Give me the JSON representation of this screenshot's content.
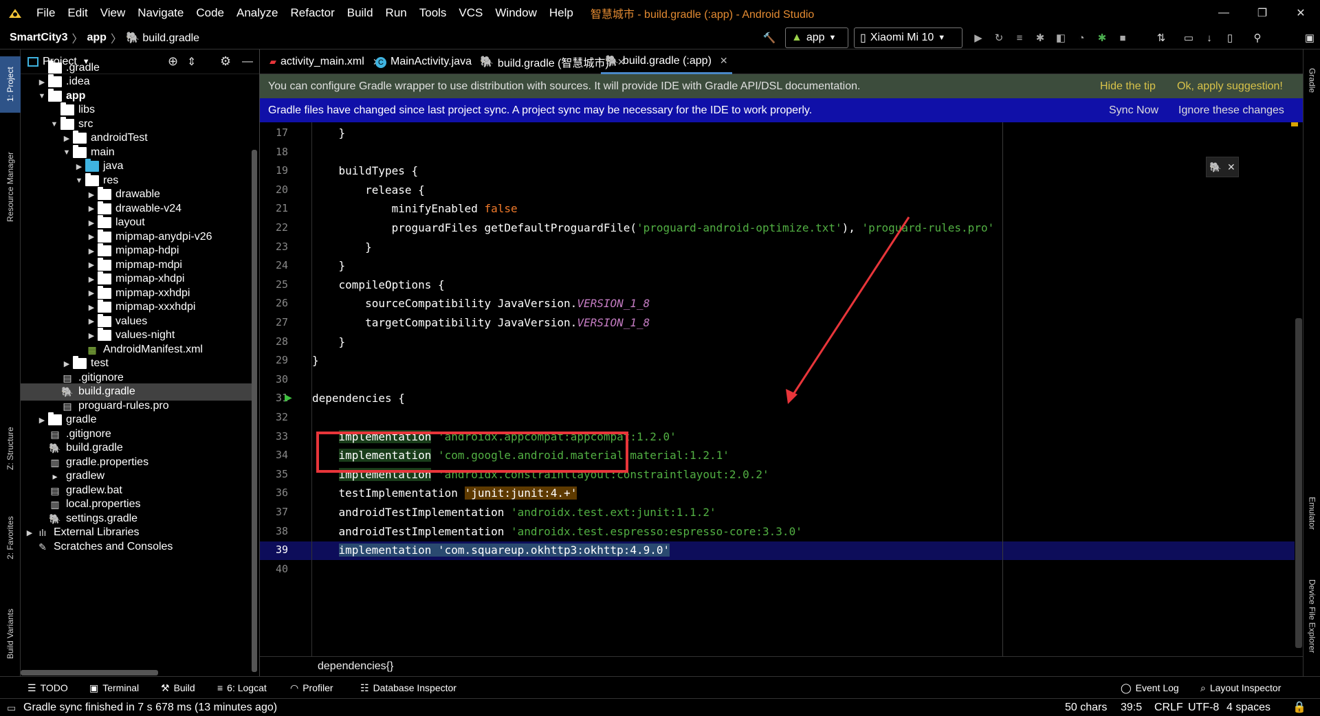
{
  "menubar": {
    "items": [
      "File",
      "Edit",
      "View",
      "Navigate",
      "Code",
      "Analyze",
      "Refactor",
      "Build",
      "Run",
      "Tools",
      "VCS",
      "Window",
      "Help"
    ],
    "window_title": "智慧城市 - build.gradle (:app) - Android Studio"
  },
  "navbar": {
    "crumbs": [
      "SmartCity3",
      "app",
      "build.gradle"
    ],
    "run_config": "app",
    "device": "Xiaomi Mi 10"
  },
  "left_strip": {
    "tabs": [
      "1: Project",
      "Resource Manager",
      "Z: Structure",
      "2: Favorites",
      "Build Variants"
    ]
  },
  "right_strip": {
    "tabs": [
      "Gradle",
      "Emulator",
      "Device File Explorer"
    ]
  },
  "project_panel": {
    "title": "Project",
    "tree": [
      {
        "label": ".gradle",
        "indent": 1,
        "arrow": "",
        "icon": "folder"
      },
      {
        "label": ".idea",
        "indent": 1,
        "arrow": "▶",
        "icon": "folder"
      },
      {
        "label": "app",
        "indent": 1,
        "arrow": "▼",
        "icon": "folder",
        "bold": true
      },
      {
        "label": "libs",
        "indent": 2,
        "arrow": "",
        "icon": "folder"
      },
      {
        "label": "src",
        "indent": 2,
        "arrow": "▼",
        "icon": "folder"
      },
      {
        "label": "androidTest",
        "indent": 3,
        "arrow": "▶",
        "icon": "folder"
      },
      {
        "label": "main",
        "indent": 3,
        "arrow": "▼",
        "icon": "folder"
      },
      {
        "label": "java",
        "indent": 4,
        "arrow": "▶",
        "icon": "folder-blue"
      },
      {
        "label": "res",
        "indent": 4,
        "arrow": "▼",
        "icon": "folder"
      },
      {
        "label": "drawable",
        "indent": 5,
        "arrow": "▶",
        "icon": "folder"
      },
      {
        "label": "drawable-v24",
        "indent": 5,
        "arrow": "▶",
        "icon": "folder"
      },
      {
        "label": "layout",
        "indent": 5,
        "arrow": "▶",
        "icon": "folder"
      },
      {
        "label": "mipmap-anydpi-v26",
        "indent": 5,
        "arrow": "▶",
        "icon": "folder"
      },
      {
        "label": "mipmap-hdpi",
        "indent": 5,
        "arrow": "▶",
        "icon": "folder"
      },
      {
        "label": "mipmap-mdpi",
        "indent": 5,
        "arrow": "▶",
        "icon": "folder"
      },
      {
        "label": "mipmap-xhdpi",
        "indent": 5,
        "arrow": "▶",
        "icon": "folder"
      },
      {
        "label": "mipmap-xxhdpi",
        "indent": 5,
        "arrow": "▶",
        "icon": "folder"
      },
      {
        "label": "mipmap-xxxhdpi",
        "indent": 5,
        "arrow": "▶",
        "icon": "folder"
      },
      {
        "label": "values",
        "indent": 5,
        "arrow": "▶",
        "icon": "folder"
      },
      {
        "label": "values-night",
        "indent": 5,
        "arrow": "▶",
        "icon": "folder"
      },
      {
        "label": "AndroidManifest.xml",
        "indent": 4,
        "arrow": "",
        "icon": "manifest"
      },
      {
        "label": "test",
        "indent": 3,
        "arrow": "▶",
        "icon": "folder"
      },
      {
        "label": ".gitignore",
        "indent": 2,
        "arrow": "",
        "icon": "file"
      },
      {
        "label": "build.gradle",
        "indent": 2,
        "arrow": "",
        "icon": "gradle",
        "selected": true
      },
      {
        "label": "proguard-rules.pro",
        "indent": 2,
        "arrow": "",
        "icon": "file"
      },
      {
        "label": "gradle",
        "indent": 1,
        "arrow": "▶",
        "icon": "folder"
      },
      {
        "label": ".gitignore",
        "indent": 1,
        "arrow": "",
        "icon": "file"
      },
      {
        "label": "build.gradle",
        "indent": 1,
        "arrow": "",
        "icon": "gradle"
      },
      {
        "label": "gradle.properties",
        "indent": 1,
        "arrow": "",
        "icon": "props"
      },
      {
        "label": "gradlew",
        "indent": 1,
        "arrow": "",
        "icon": "terminal"
      },
      {
        "label": "gradlew.bat",
        "indent": 1,
        "arrow": "",
        "icon": "file"
      },
      {
        "label": "local.properties",
        "indent": 1,
        "arrow": "",
        "icon": "props"
      },
      {
        "label": "settings.gradle",
        "indent": 1,
        "arrow": "",
        "icon": "gradle"
      },
      {
        "label": "External Libraries",
        "indent": 0,
        "arrow": "▶",
        "icon": "libs"
      },
      {
        "label": "Scratches and Consoles",
        "indent": 0,
        "arrow": "",
        "icon": "scratch"
      }
    ]
  },
  "tabs": [
    {
      "label": "activity_main.xml",
      "icon": "xml"
    },
    {
      "label": "MainActivity.java",
      "icon": "class"
    },
    {
      "label": "build.gradle (智慧城市)",
      "icon": "gradle"
    },
    {
      "label": "build.gradle (:app)",
      "icon": "gradle",
      "active": true
    }
  ],
  "banners": {
    "wrapper_text": "You can configure Gradle wrapper to use distribution with sources. It will provide IDE with Gradle API/DSL documentation.",
    "hide_tip": "Hide the tip",
    "apply_suggestion": "Ok, apply suggestion!",
    "sync_text": "Gradle files have changed since last project sync. A project sync may be necessary for the IDE to work properly.",
    "sync_now": "Sync Now",
    "ignore_changes": "Ignore these changes"
  },
  "editor": {
    "lines": [
      {
        "n": "17",
        "code": [
          {
            "t": "    }"
          }
        ]
      },
      {
        "n": "18",
        "code": []
      },
      {
        "n": "19",
        "code": [
          {
            "t": "    buildTypes {"
          }
        ]
      },
      {
        "n": "20",
        "code": [
          {
            "t": "        release {"
          }
        ]
      },
      {
        "n": "21",
        "code": [
          {
            "t": "            minifyEnabled "
          },
          {
            "t": "false",
            "c": "kw"
          }
        ]
      },
      {
        "n": "22",
        "code": [
          {
            "t": "            proguardFiles getDefaultProguardFile("
          },
          {
            "t": "'proguard-android-optimize.txt'",
            "c": "str"
          },
          {
            "t": "), "
          },
          {
            "t": "'proguard-rules.pro'",
            "c": "str"
          }
        ]
      },
      {
        "n": "23",
        "code": [
          {
            "t": "        }"
          }
        ]
      },
      {
        "n": "24",
        "code": [
          {
            "t": "    }"
          }
        ]
      },
      {
        "n": "25",
        "code": [
          {
            "t": "    compileOptions {"
          }
        ]
      },
      {
        "n": "26",
        "code": [
          {
            "t": "        sourceCompatibility JavaVersion."
          },
          {
            "t": "VERSION_1_8",
            "c": "it"
          }
        ]
      },
      {
        "n": "27",
        "code": [
          {
            "t": "        targetCompatibility JavaVersion."
          },
          {
            "t": "VERSION_1_8",
            "c": "it"
          }
        ]
      },
      {
        "n": "28",
        "code": [
          {
            "t": "    }"
          }
        ]
      },
      {
        "n": "29",
        "code": [
          {
            "t": "}"
          }
        ]
      },
      {
        "n": "30",
        "code": []
      },
      {
        "n": "31",
        "code": [
          {
            "t": "dependencies {"
          }
        ]
      },
      {
        "n": "32",
        "code": []
      },
      {
        "n": "33",
        "code": [
          {
            "t": "    "
          },
          {
            "t": "implementation",
            "c": "hlgreen"
          },
          {
            "t": " "
          },
          {
            "t": "'androidx.appcompat:appcompat:1.2.0'",
            "c": "str"
          }
        ]
      },
      {
        "n": "34",
        "code": [
          {
            "t": "    "
          },
          {
            "t": "implementation",
            "c": "hlgreen"
          },
          {
            "t": " "
          },
          {
            "t": "'com.google.android.material:material:1.2.1'",
            "c": "str"
          }
        ]
      },
      {
        "n": "35",
        "code": [
          {
            "t": "    "
          },
          {
            "t": "implementation",
            "c": "hlgreen"
          },
          {
            "t": " "
          },
          {
            "t": "'androidx.constraintlayout:constraintlayout:2.0.2'",
            "c": "str"
          }
        ]
      },
      {
        "n": "36",
        "code": [
          {
            "t": "    testImplementation "
          },
          {
            "t": "'junit:junit:4.+'",
            "c": "hlorange"
          }
        ]
      },
      {
        "n": "37",
        "code": [
          {
            "t": "    androidTestImplementation "
          },
          {
            "t": "'androidx.test.ext:junit:1.1.2'",
            "c": "str"
          }
        ]
      },
      {
        "n": "38",
        "code": [
          {
            "t": "    androidTestImplementation "
          },
          {
            "t": "'androidx.test.espresso:espresso-core:3.3.0'",
            "c": "str"
          }
        ]
      },
      {
        "n": "39",
        "code": [
          {
            "t": "    "
          },
          {
            "t": "implementation 'com.squareup.okhttp3:okhttp:4.9.0'",
            "c": "selbg"
          }
        ],
        "current": true
      },
      {
        "n": "40",
        "code": []
      }
    ],
    "breadcrumb": "dependencies{}"
  },
  "bottom_tools": {
    "left": [
      "TODO",
      "Terminal",
      "Build",
      "6: Logcat",
      "Profiler",
      "Database Inspector"
    ],
    "right": [
      "Event Log",
      "Layout Inspector"
    ]
  },
  "status": {
    "message": "Gradle sync finished in 7 s 678 ms (13 minutes ago)",
    "chars": "50 chars",
    "position": "39:5",
    "line_sep": "CRLF",
    "encoding": "UTF-8",
    "indent": "4 spaces"
  },
  "colors": {
    "accent": "#4a88c7",
    "annotation_red": "#e8353a",
    "keyword": "#f07a2b",
    "string": "#52b043"
  }
}
